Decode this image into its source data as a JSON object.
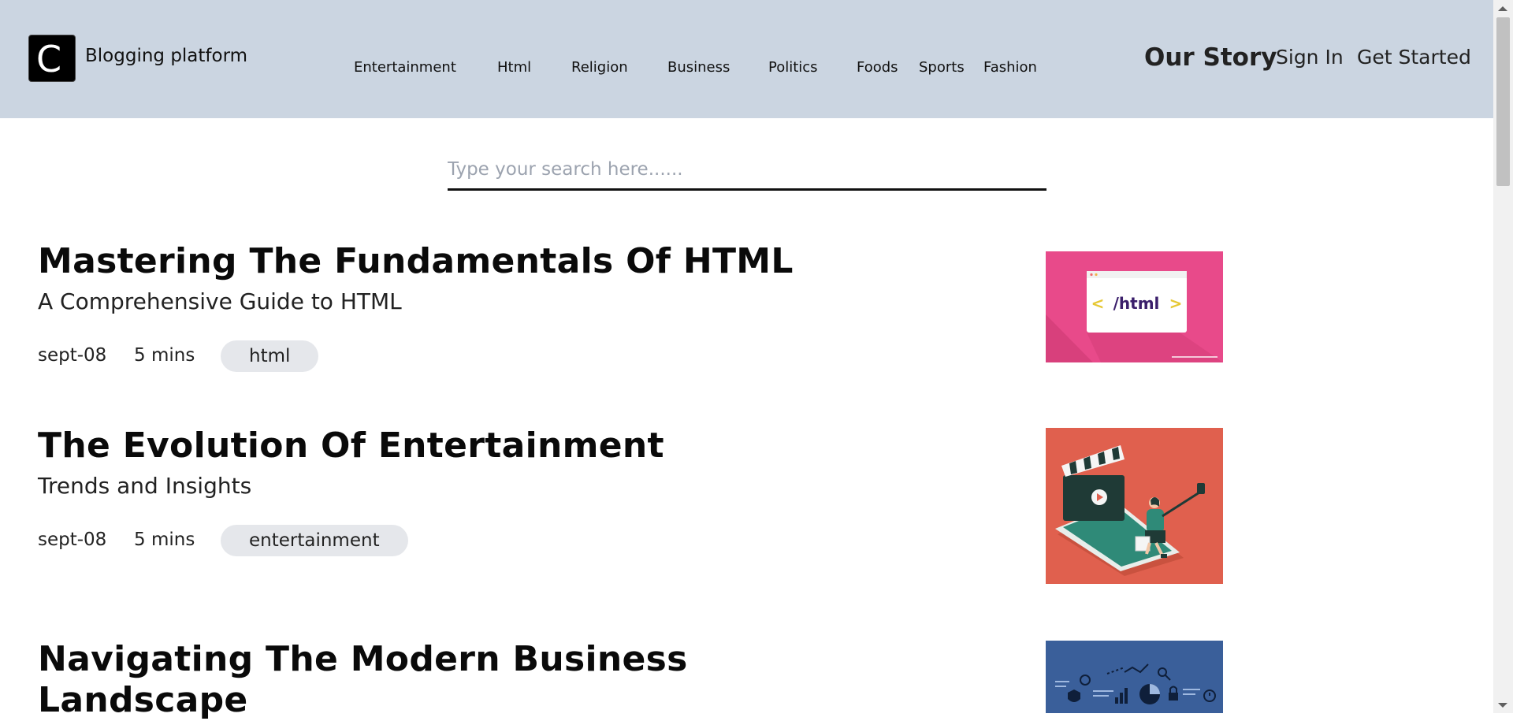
{
  "header": {
    "logo_letter": "C",
    "brand": "Blogging platform",
    "nav": [
      "Entertainment",
      "Html",
      "Religion",
      "Business",
      "Politics",
      "Foods",
      "Sports",
      "Fashion"
    ],
    "our_story": "Our Story",
    "sign_in": "Sign In",
    "get_started": "Get Started",
    "background_color": "#cbd5e1"
  },
  "search": {
    "placeholder": "Type your search here......",
    "value": ""
  },
  "articles": [
    {
      "title": "Mastering The Fundamentals Of HTML",
      "subtitle": "A Comprehensive Guide to HTML",
      "date": "sept-08",
      "read_time": "5 mins",
      "tag": "html",
      "thumbnail": {
        "icon": "html-code-icon",
        "text": "</html>",
        "background": "#e84a8a"
      }
    },
    {
      "title": "The Evolution Of Entertainment",
      "subtitle": "Trends and Insights",
      "date": "sept-08",
      "read_time": "5 mins",
      "tag": "entertainment",
      "thumbnail": {
        "icon": "clapperboard-selfie-icon",
        "background": "#e0604e"
      }
    },
    {
      "title": "Navigating The Modern Business Landscape",
      "thumbnail": {
        "icon": "business-analytics-icon",
        "background": "#3a5f9a"
      }
    }
  ]
}
